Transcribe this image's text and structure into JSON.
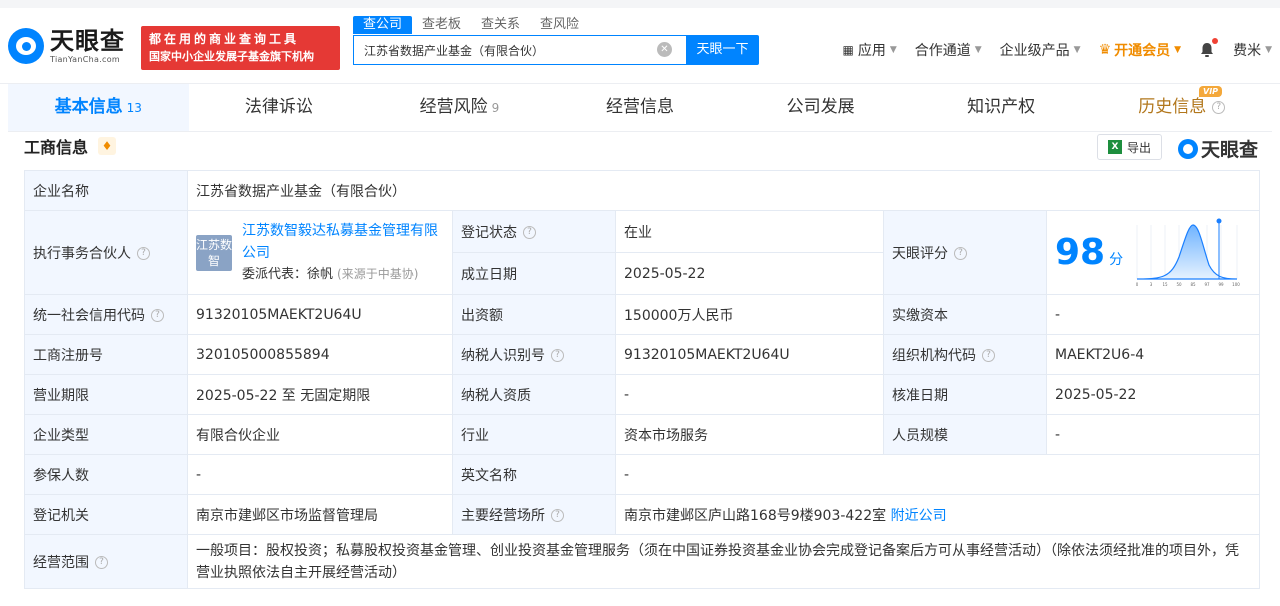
{
  "brand": {
    "logo_cn": "天眼查",
    "logo_en": "TianYanCha.com",
    "banner_line1": "都在用的商业查询工具",
    "banner_line2": "国家中小企业发展子基金旗下机构"
  },
  "search": {
    "tabs": [
      "查公司",
      "查老板",
      "查关系",
      "查风险"
    ],
    "query": "江苏省数据产业基金（有限合伙）",
    "button": "天眼一下"
  },
  "nav": {
    "items": [
      "应用",
      "合作通道",
      "企业级产品"
    ],
    "vip": "开通会员",
    "user": "费米"
  },
  "tabs": [
    {
      "label": "基本信息",
      "count": "13"
    },
    {
      "label": "法律诉讼",
      "count": ""
    },
    {
      "label": "经营风险",
      "count": "9"
    },
    {
      "label": "经营信息",
      "count": ""
    },
    {
      "label": "公司发展",
      "count": ""
    },
    {
      "label": "知识产权",
      "count": ""
    },
    {
      "label": "历史信息",
      "count": ""
    }
  ],
  "vip_badge": "VIP",
  "section": {
    "title": "工商信息",
    "export": "导出",
    "watermark": "天眼查"
  },
  "info": {
    "company_name_label": "企业名称",
    "company_name": "江苏省数据产业基金（有限合伙）",
    "partner_label": "执行事务合伙人",
    "partner_avatar": "江苏数智",
    "partner_name": "江苏数智毅达私募基金管理有限公司",
    "delegate_label": "委派代表：",
    "delegate_name": "徐帆",
    "delegate_source": "(来源于中基协)",
    "reg_status_label": "登记状态",
    "reg_status": "在业",
    "est_date_label": "成立日期",
    "est_date": "2025-05-22",
    "score_label": "天眼评分",
    "score": "98",
    "score_unit": "分",
    "score_axis": [
      "0",
      "3",
      "15",
      "50",
      "85",
      "97",
      "99",
      "100"
    ],
    "credit_code_label": "统一社会信用代码",
    "credit_code": "91320105MAEKT2U64U",
    "capital_label": "出资额",
    "capital": "150000万人民币",
    "paid_label": "实缴资本",
    "paid": "-",
    "reg_no_label": "工商注册号",
    "reg_no": "320105000855894",
    "tax_id_label": "纳税人识别号",
    "tax_id": "91320105MAEKT2U64U",
    "org_code_label": "组织机构代码",
    "org_code": "MAEKT2U6-4",
    "term_label": "营业期限",
    "term": "2025-05-22 至 无固定期限",
    "tax_qual_label": "纳税人资质",
    "tax_qual": "-",
    "approve_label": "核准日期",
    "approve": "2025-05-22",
    "type_label": "企业类型",
    "type": "有限合伙企业",
    "industry_label": "行业",
    "industry": "资本市场服务",
    "staff_label": "人员规模",
    "staff": "-",
    "insured_label": "参保人数",
    "insured": "-",
    "en_name_label": "英文名称",
    "en_name": "-",
    "authority_label": "登记机关",
    "authority": "南京市建邺区市场监督管理局",
    "address_label": "主要经营场所",
    "address": "南京市建邺区庐山路168号9楼903-422室",
    "nearby": "附近公司",
    "scope_label": "经营范围",
    "scope": "一般项目：股权投资；私募股权投资基金管理、创业投资基金管理服务（须在中国证券投资基金业协会完成登记备案后方可从事经营活动）（除依法须经批准的项目外，凭营业执照依法自主开展经营活动）"
  }
}
